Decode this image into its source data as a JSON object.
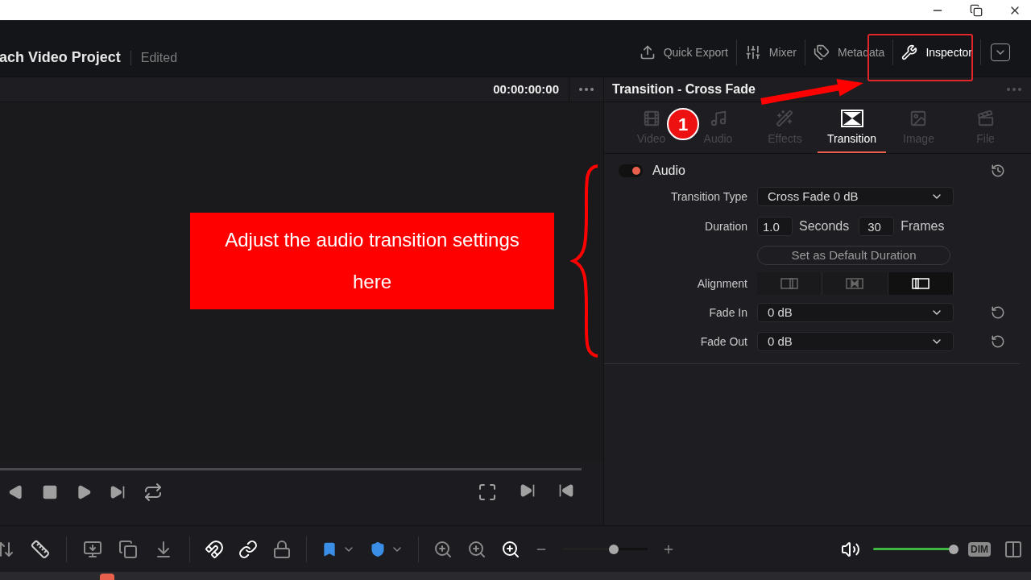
{
  "header": {
    "project_title": "ach Video Project",
    "status": "Edited",
    "tools": [
      {
        "label": "Quick Export",
        "kind": "export",
        "selected": false
      },
      {
        "label": "Mixer",
        "kind": "mixer",
        "selected": false
      },
      {
        "label": "Metadata",
        "kind": "metadata",
        "selected": false
      },
      {
        "label": "Inspector",
        "kind": "inspector",
        "selected": true
      }
    ]
  },
  "viewer": {
    "timecode": "00:00:00:00"
  },
  "inspector": {
    "title": "Transition - Cross Fade",
    "tabs": [
      {
        "label": "Video",
        "kind": "video",
        "selected": false
      },
      {
        "label": "Audio",
        "kind": "audio",
        "selected": false
      },
      {
        "label": "Effects",
        "kind": "effects",
        "selected": false
      },
      {
        "label": "Transition",
        "kind": "transition",
        "selected": true
      },
      {
        "label": "Image",
        "kind": "image",
        "selected": false
      },
      {
        "label": "File",
        "kind": "file",
        "selected": false
      }
    ],
    "section": {
      "title": "Audio",
      "on": true
    },
    "transition_type": {
      "label": "Transition Type",
      "value": "Cross Fade 0 dB"
    },
    "duration": {
      "label": "Duration",
      "seconds": "1.0",
      "seconds_unit": "Seconds",
      "frames": "30",
      "frames_unit": "Frames"
    },
    "default_button": "Set as Default Duration",
    "alignment": {
      "label": "Alignment",
      "options": [
        {
          "kind": "end",
          "selected": false
        },
        {
          "kind": "center",
          "selected": false
        },
        {
          "kind": "start",
          "selected": true
        }
      ]
    },
    "fade_in": {
      "label": "Fade In",
      "value": "0 dB"
    },
    "fade_out": {
      "label": "Fade Out",
      "value": "0 dB"
    }
  },
  "toolbar": {
    "zoom": {
      "level": 0.6
    },
    "volume": {
      "level": 0.98
    },
    "dim": "DIM"
  },
  "annotations": {
    "callout": "Adjust the audio transition settings here",
    "step_badge": "1"
  }
}
